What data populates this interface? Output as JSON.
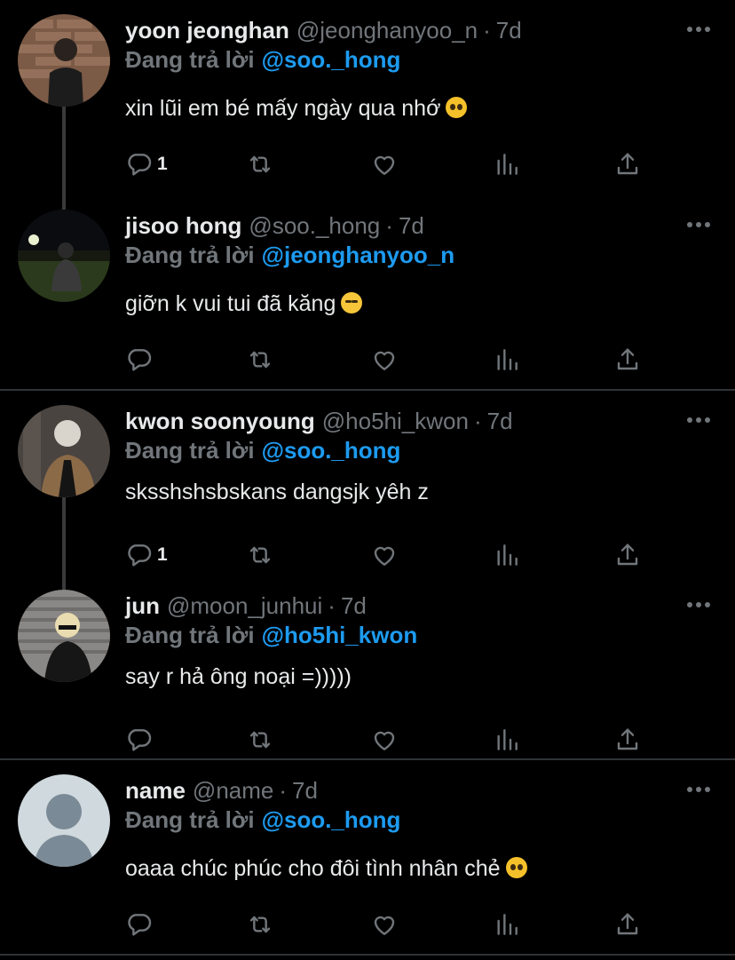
{
  "reply_prefix": "Đang trả lời",
  "tweets": [
    {
      "name": "yoon jeonghan",
      "handle": "@jeonghanyoo_n",
      "dot": "·",
      "time": "7d",
      "reply_to": "@soo._hong",
      "text": "xin lũi em bé mấy ngày qua nhớ",
      "emoji": "pleading-face",
      "reply_count": "1"
    },
    {
      "name": "jisoo hong",
      "handle": "@soo._hong",
      "dot": "·",
      "time": "7d",
      "reply_to": "@jeonghanyoo_n",
      "text": "giỡn k vui tui đã kăng",
      "emoji": "crying-face",
      "reply_count": ""
    },
    {
      "name": "kwon soonyoung",
      "handle": "@ho5hi_kwon",
      "dot": "·",
      "time": "7d",
      "reply_to": "@soo._hong",
      "text": "sksshshsbskans dangsjk yêh z",
      "emoji": "",
      "reply_count": "1"
    },
    {
      "name": "jun",
      "handle": "@moon_junhui",
      "dot": "·",
      "time": "7d",
      "reply_to": "@ho5hi_kwon",
      "text": "say r hả ông noại =)))))",
      "emoji": "",
      "reply_count": ""
    },
    {
      "name": "name",
      "handle": "@name",
      "dot": "·",
      "time": "7d",
      "reply_to": "@soo._hong",
      "text": "oaaa chúc phúc cho đôi tình nhân chẻ",
      "emoji": "pleading-face",
      "reply_count": ""
    }
  ],
  "colors": {
    "accent": "#1d9bf0",
    "muted": "#71767b",
    "text": "#e7e9ea",
    "background": "#000000"
  }
}
